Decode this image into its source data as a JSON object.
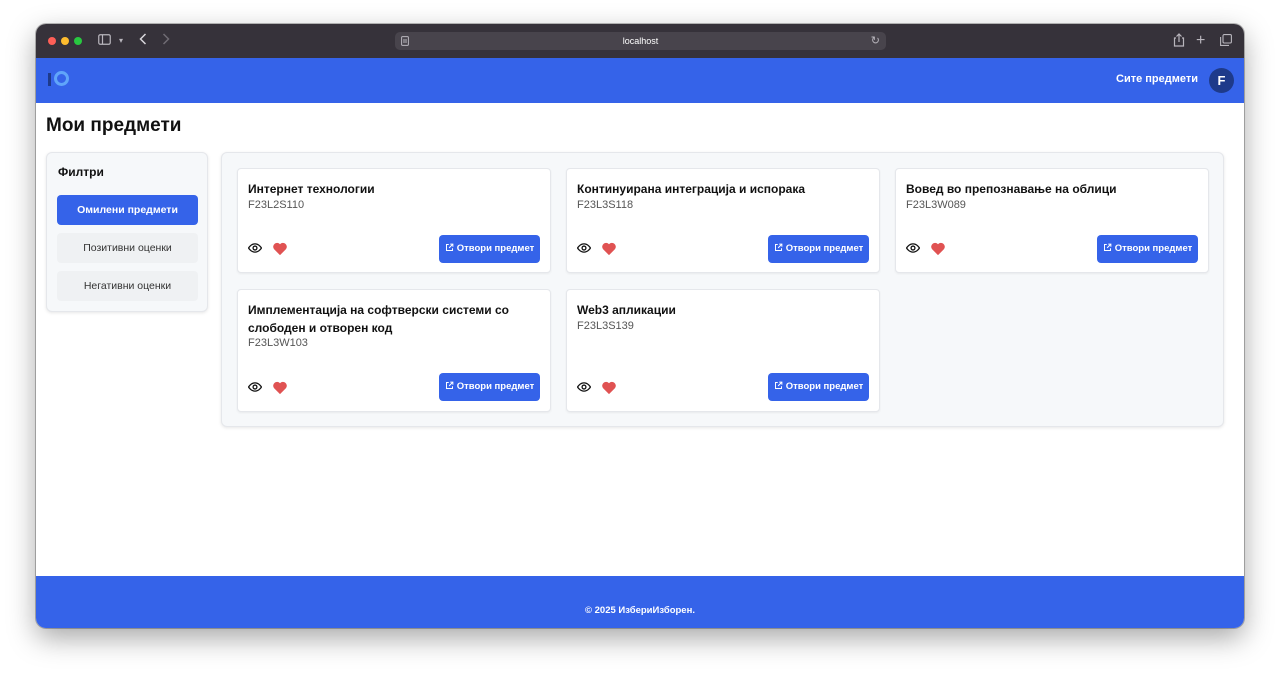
{
  "browser": {
    "url": "localhost",
    "icons": [
      "sidebar-icon",
      "chevron-down-icon",
      "back-icon",
      "forward-icon",
      "page-settings-icon",
      "reload-icon",
      "share-icon",
      "new-tab-icon",
      "tabs-overview-icon"
    ]
  },
  "header": {
    "nav_all_subjects": "Сите предмети",
    "avatar_initial": "F",
    "brand_color": "#3563e9"
  },
  "page": {
    "title": "Мои предмети"
  },
  "filters": {
    "title": "Филтри",
    "items": [
      {
        "label": "Омилени предмети",
        "active": true
      },
      {
        "label": "Позитивни оценки",
        "active": false
      },
      {
        "label": "Негативни оценки",
        "active": false
      }
    ]
  },
  "courses": [
    {
      "title": "Интернет технологии",
      "code": "F23L2S110",
      "favorite": true
    },
    {
      "title": "Континуирана интеграција и испорака",
      "code": "F23L3S118",
      "favorite": true
    },
    {
      "title": "Вовед во препознавање на облици",
      "code": "F23L3W089",
      "favorite": true
    },
    {
      "title": "Имплементација на софтверски системи со слободен и отворен код",
      "code": "F23L3W103",
      "favorite": true
    },
    {
      "title": "Web3 апликации",
      "code": "F23L3S139",
      "favorite": true
    }
  ],
  "course_button_label": "Отвори предмет",
  "heart_color": "#e05252",
  "footer": {
    "text": "© 2025 ИзбериИзборен."
  }
}
